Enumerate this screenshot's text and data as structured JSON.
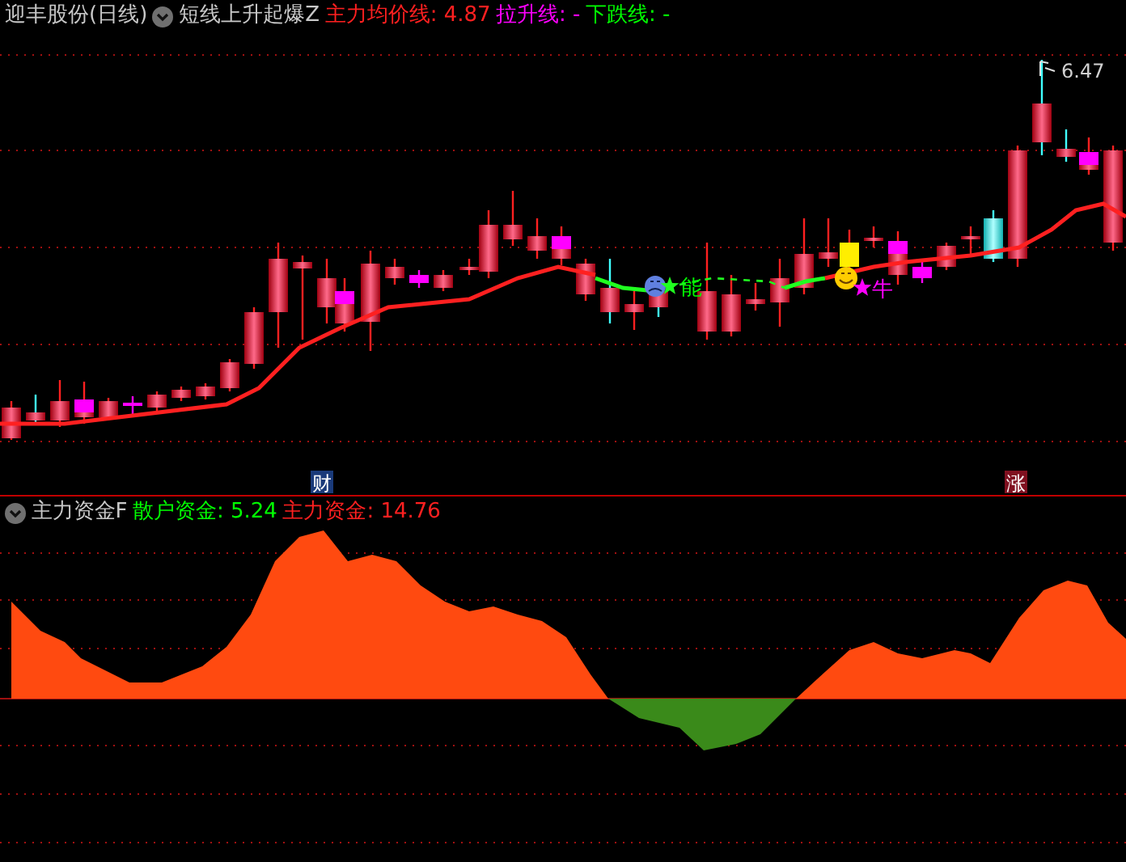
{
  "price_panel": {
    "stock": "迎丰股份(日线)",
    "indicator": "短线上升起爆Z",
    "legend": [
      {
        "label": "主力均价线: 4.87",
        "color": "#ff2020"
      },
      {
        "label": "拉升线: -",
        "color": "#ff00ff"
      },
      {
        "label": "下跌线: -",
        "color": "#00ff00"
      }
    ],
    "high_label": "6.47",
    "signals": [
      {
        "text": "能",
        "color": "#00ff00"
      },
      {
        "text": "牛",
        "color": "#ff00ff"
      }
    ],
    "date_tags": [
      {
        "text": "财",
        "color": "#1a3a7a"
      },
      {
        "text": "涨",
        "color": "#801020"
      }
    ]
  },
  "fund_panel": {
    "title": "主力资金F",
    "legend": [
      {
        "label": "散户资金: 5.24",
        "color": "#00ff00"
      },
      {
        "label": "主力资金: 14.76",
        "color": "#ff2020"
      }
    ]
  }
}
